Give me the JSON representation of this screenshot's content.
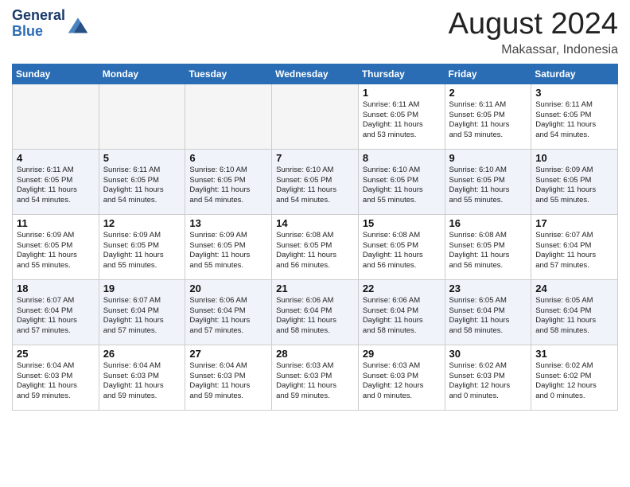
{
  "header": {
    "logo_line1": "General",
    "logo_line2": "Blue",
    "month_year": "August 2024",
    "location": "Makassar, Indonesia"
  },
  "weekdays": [
    "Sunday",
    "Monday",
    "Tuesday",
    "Wednesday",
    "Thursday",
    "Friday",
    "Saturday"
  ],
  "weeks": [
    [
      {
        "day": "",
        "empty": true
      },
      {
        "day": "",
        "empty": true
      },
      {
        "day": "",
        "empty": true
      },
      {
        "day": "",
        "empty": true
      },
      {
        "day": "1",
        "sunrise": "Sunrise: 6:11 AM",
        "sunset": "Sunset: 6:05 PM",
        "daylight": "Daylight: 11 hours and 53 minutes."
      },
      {
        "day": "2",
        "sunrise": "Sunrise: 6:11 AM",
        "sunset": "Sunset: 6:05 PM",
        "daylight": "Daylight: 11 hours and 53 minutes."
      },
      {
        "day": "3",
        "sunrise": "Sunrise: 6:11 AM",
        "sunset": "Sunset: 6:05 PM",
        "daylight": "Daylight: 11 hours and 54 minutes."
      }
    ],
    [
      {
        "day": "4",
        "sunrise": "Sunrise: 6:11 AM",
        "sunset": "Sunset: 6:05 PM",
        "daylight": "Daylight: 11 hours and 54 minutes."
      },
      {
        "day": "5",
        "sunrise": "Sunrise: 6:11 AM",
        "sunset": "Sunset: 6:05 PM",
        "daylight": "Daylight: 11 hours and 54 minutes."
      },
      {
        "day": "6",
        "sunrise": "Sunrise: 6:10 AM",
        "sunset": "Sunset: 6:05 PM",
        "daylight": "Daylight: 11 hours and 54 minutes."
      },
      {
        "day": "7",
        "sunrise": "Sunrise: 6:10 AM",
        "sunset": "Sunset: 6:05 PM",
        "daylight": "Daylight: 11 hours and 54 minutes."
      },
      {
        "day": "8",
        "sunrise": "Sunrise: 6:10 AM",
        "sunset": "Sunset: 6:05 PM",
        "daylight": "Daylight: 11 hours and 55 minutes."
      },
      {
        "day": "9",
        "sunrise": "Sunrise: 6:10 AM",
        "sunset": "Sunset: 6:05 PM",
        "daylight": "Daylight: 11 hours and 55 minutes."
      },
      {
        "day": "10",
        "sunrise": "Sunrise: 6:09 AM",
        "sunset": "Sunset: 6:05 PM",
        "daylight": "Daylight: 11 hours and 55 minutes."
      }
    ],
    [
      {
        "day": "11",
        "sunrise": "Sunrise: 6:09 AM",
        "sunset": "Sunset: 6:05 PM",
        "daylight": "Daylight: 11 hours and 55 minutes."
      },
      {
        "day": "12",
        "sunrise": "Sunrise: 6:09 AM",
        "sunset": "Sunset: 6:05 PM",
        "daylight": "Daylight: 11 hours and 55 minutes."
      },
      {
        "day": "13",
        "sunrise": "Sunrise: 6:09 AM",
        "sunset": "Sunset: 6:05 PM",
        "daylight": "Daylight: 11 hours and 55 minutes."
      },
      {
        "day": "14",
        "sunrise": "Sunrise: 6:08 AM",
        "sunset": "Sunset: 6:05 PM",
        "daylight": "Daylight: 11 hours and 56 minutes."
      },
      {
        "day": "15",
        "sunrise": "Sunrise: 6:08 AM",
        "sunset": "Sunset: 6:05 PM",
        "daylight": "Daylight: 11 hours and 56 minutes."
      },
      {
        "day": "16",
        "sunrise": "Sunrise: 6:08 AM",
        "sunset": "Sunset: 6:05 PM",
        "daylight": "Daylight: 11 hours and 56 minutes."
      },
      {
        "day": "17",
        "sunrise": "Sunrise: 6:07 AM",
        "sunset": "Sunset: 6:04 PM",
        "daylight": "Daylight: 11 hours and 57 minutes."
      }
    ],
    [
      {
        "day": "18",
        "sunrise": "Sunrise: 6:07 AM",
        "sunset": "Sunset: 6:04 PM",
        "daylight": "Daylight: 11 hours and 57 minutes."
      },
      {
        "day": "19",
        "sunrise": "Sunrise: 6:07 AM",
        "sunset": "Sunset: 6:04 PM",
        "daylight": "Daylight: 11 hours and 57 minutes."
      },
      {
        "day": "20",
        "sunrise": "Sunrise: 6:06 AM",
        "sunset": "Sunset: 6:04 PM",
        "daylight": "Daylight: 11 hours and 57 minutes."
      },
      {
        "day": "21",
        "sunrise": "Sunrise: 6:06 AM",
        "sunset": "Sunset: 6:04 PM",
        "daylight": "Daylight: 11 hours and 58 minutes."
      },
      {
        "day": "22",
        "sunrise": "Sunrise: 6:06 AM",
        "sunset": "Sunset: 6:04 PM",
        "daylight": "Daylight: 11 hours and 58 minutes."
      },
      {
        "day": "23",
        "sunrise": "Sunrise: 6:05 AM",
        "sunset": "Sunset: 6:04 PM",
        "daylight": "Daylight: 11 hours and 58 minutes."
      },
      {
        "day": "24",
        "sunrise": "Sunrise: 6:05 AM",
        "sunset": "Sunset: 6:04 PM",
        "daylight": "Daylight: 11 hours and 58 minutes."
      }
    ],
    [
      {
        "day": "25",
        "sunrise": "Sunrise: 6:04 AM",
        "sunset": "Sunset: 6:03 PM",
        "daylight": "Daylight: 11 hours and 59 minutes."
      },
      {
        "day": "26",
        "sunrise": "Sunrise: 6:04 AM",
        "sunset": "Sunset: 6:03 PM",
        "daylight": "Daylight: 11 hours and 59 minutes."
      },
      {
        "day": "27",
        "sunrise": "Sunrise: 6:04 AM",
        "sunset": "Sunset: 6:03 PM",
        "daylight": "Daylight: 11 hours and 59 minutes."
      },
      {
        "day": "28",
        "sunrise": "Sunrise: 6:03 AM",
        "sunset": "Sunset: 6:03 PM",
        "daylight": "Daylight: 11 hours and 59 minutes."
      },
      {
        "day": "29",
        "sunrise": "Sunrise: 6:03 AM",
        "sunset": "Sunset: 6:03 PM",
        "daylight": "Daylight: 12 hours and 0 minutes."
      },
      {
        "day": "30",
        "sunrise": "Sunrise: 6:02 AM",
        "sunset": "Sunset: 6:03 PM",
        "daylight": "Daylight: 12 hours and 0 minutes."
      },
      {
        "day": "31",
        "sunrise": "Sunrise: 6:02 AM",
        "sunset": "Sunset: 6:02 PM",
        "daylight": "Daylight: 12 hours and 0 minutes."
      }
    ]
  ]
}
